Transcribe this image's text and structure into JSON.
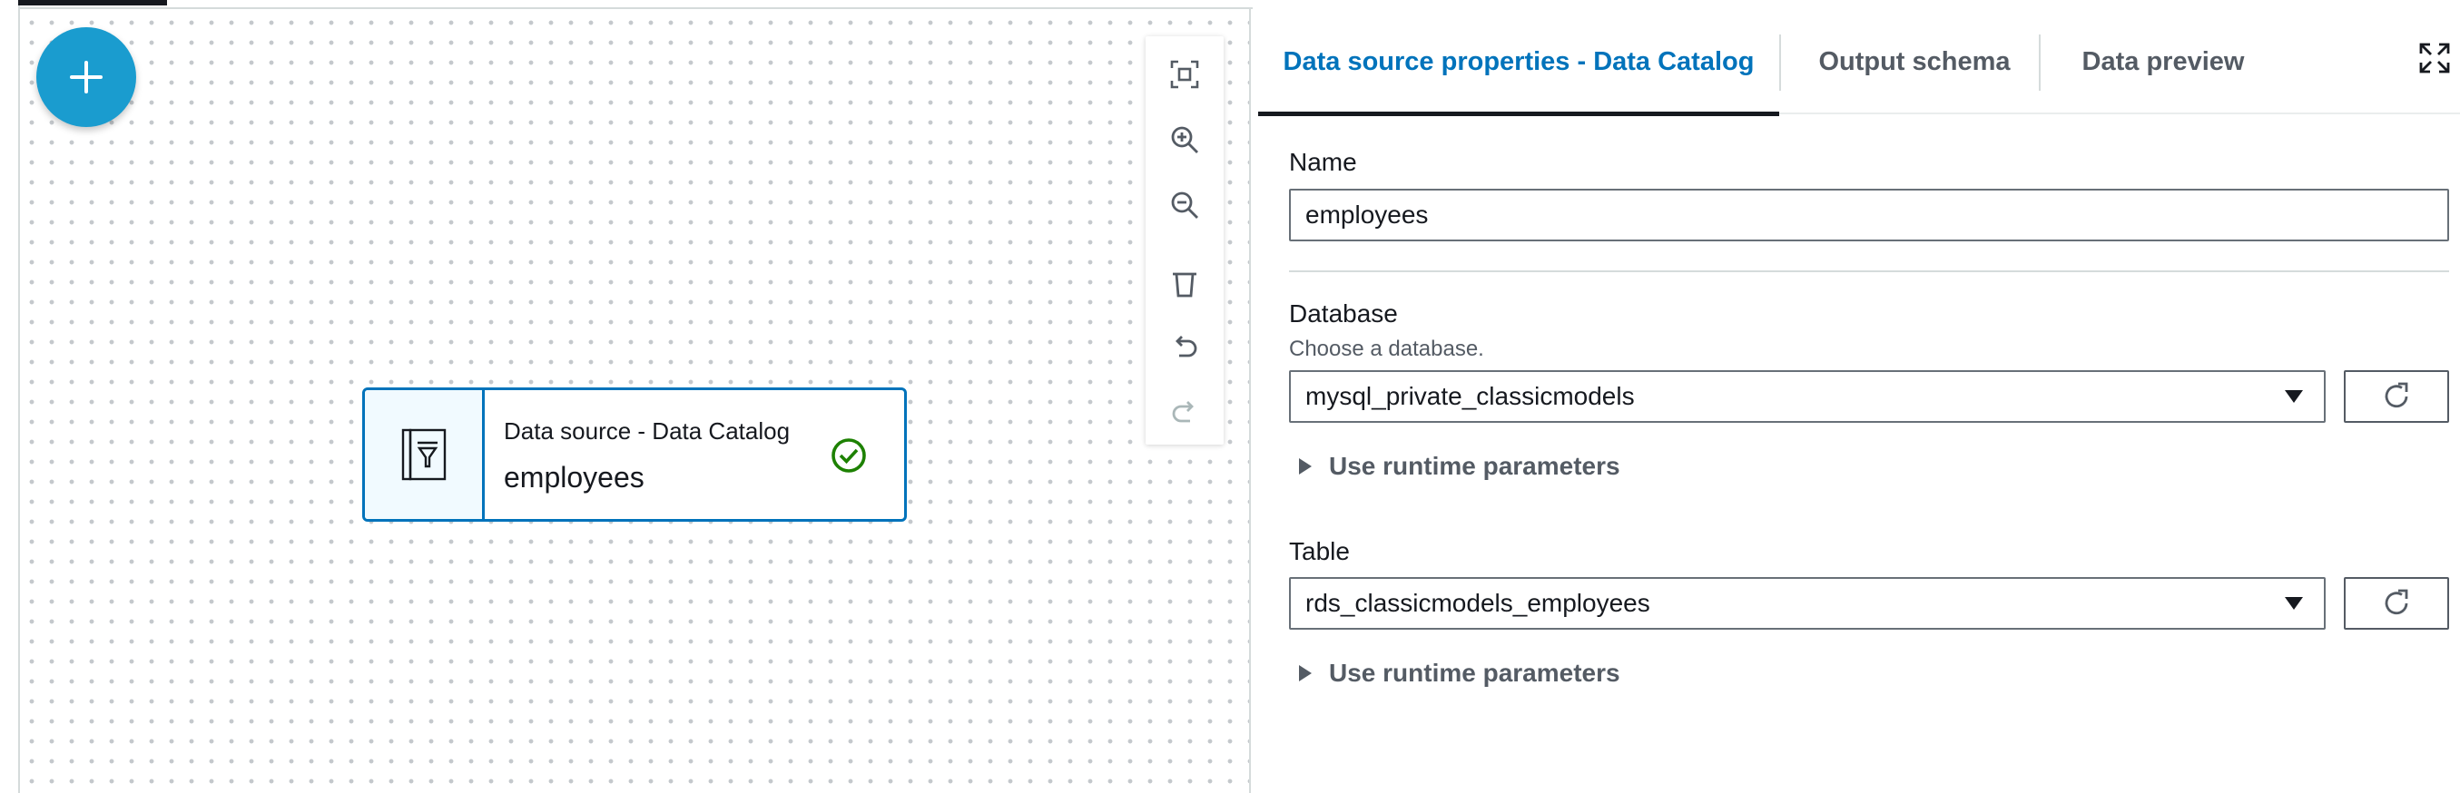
{
  "canvas": {
    "add_button_label": "+",
    "toolbar": [
      {
        "name": "fit-view-icon"
      },
      {
        "name": "zoom-in-icon"
      },
      {
        "name": "zoom-out-icon"
      },
      {
        "name": "trash-icon"
      },
      {
        "name": "undo-icon"
      },
      {
        "name": "redo-icon"
      }
    ],
    "node": {
      "type_label": "Data source - Data Catalog",
      "name": "employees",
      "icon": "data-catalog-icon",
      "status_icon": "success-check-icon",
      "status_color": "#1d8102"
    }
  },
  "panel": {
    "tabs": [
      {
        "label": "Data source properties - Data Catalog",
        "active": true
      },
      {
        "label": "Output schema",
        "active": false
      },
      {
        "label": "Data preview",
        "active": false
      }
    ],
    "expand_icon": "expand-icon",
    "name_field": {
      "label": "Name",
      "value": "employees"
    },
    "database_field": {
      "label": "Database",
      "description": "Choose a database.",
      "value": "mysql_private_classicmodels",
      "runtime_label": "Use runtime parameters"
    },
    "table_field": {
      "label": "Table",
      "value": "rds_classicmodels_employees",
      "runtime_label": "Use runtime parameters"
    }
  },
  "colors": {
    "accent": "#1a9ccf",
    "link": "#0073bb",
    "node_border": "#0073bb"
  }
}
